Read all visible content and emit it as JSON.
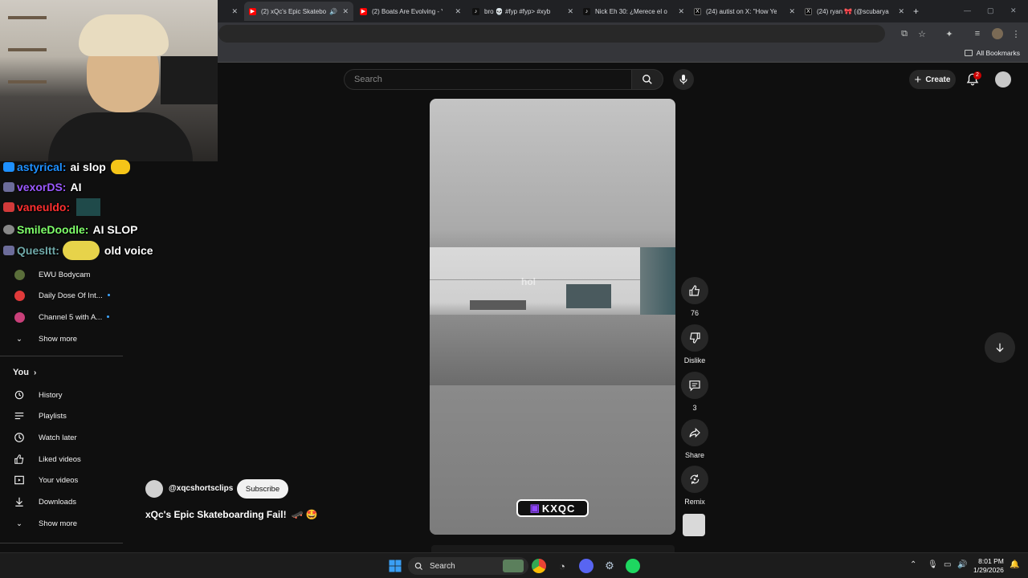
{
  "browser": {
    "tabs": [
      {
        "title": "(2) xQc's Epic Skatebo",
        "active": true,
        "audio": true
      },
      {
        "title": "(2) Boats Are Evolving - Y"
      },
      {
        "title": "bro 💀 #fyp #fyp> #xyb"
      },
      {
        "title": "Nick Eh 30: ¿Merece el oc"
      },
      {
        "title": "(24) autist on X: \"How Ye"
      },
      {
        "title": "(24) ryan 🎀 (@scubarya"
      }
    ],
    "bookmarks_label": "All Bookmarks"
  },
  "header": {
    "search_placeholder": "Search",
    "create_label": "Create",
    "notification_count": "2"
  },
  "chat": [
    {
      "user": "astyrical:",
      "message": "ai slop",
      "color": "#1e90ff"
    },
    {
      "user": "vexorDS:",
      "message": "AI",
      "color": "#8a2be2"
    },
    {
      "user": "vaneuldo:",
      "message": "",
      "color": "#ff3030"
    },
    {
      "user": "SmileDoodle:",
      "message": "AI SLOP",
      "color": "#00ff7f"
    },
    {
      "user": "QuesItt:",
      "message": "old voice",
      "color": "#5f9ea0"
    }
  ],
  "sidebar": {
    "subscriptions": [
      {
        "label": "EWU Bodycam",
        "dot": false
      },
      {
        "label": "Daily Dose Of Int...",
        "dot": true
      },
      {
        "label": "Channel 5 with A...",
        "dot": true
      }
    ],
    "show_more_1": "Show more",
    "you_title": "You",
    "you_items": [
      {
        "label": "History",
        "icon": "history-icon"
      },
      {
        "label": "Playlists",
        "icon": "playlists-icon"
      },
      {
        "label": "Watch later",
        "icon": "watch-later-icon"
      },
      {
        "label": "Liked videos",
        "icon": "liked-videos-icon"
      },
      {
        "label": "Your videos",
        "icon": "your-videos-icon"
      },
      {
        "label": "Downloads",
        "icon": "downloads-icon"
      }
    ],
    "show_more_2": "Show more"
  },
  "short": {
    "overlay_text": "hol",
    "logo_text": "KXQC",
    "channel": "@xqcshortsclips",
    "subscribe_label": "Subscribe",
    "title": "xQc's Epic Skateboarding Fail!",
    "title_emoji": "🛹 🤩"
  },
  "actions": {
    "likes": "76",
    "dislike_label": "Dislike",
    "comments": "3",
    "share_label": "Share",
    "remix_label": "Remix"
  },
  "taskbar": {
    "search_label": "Search",
    "time": "8:01 PM",
    "date": "1/29/2026"
  }
}
